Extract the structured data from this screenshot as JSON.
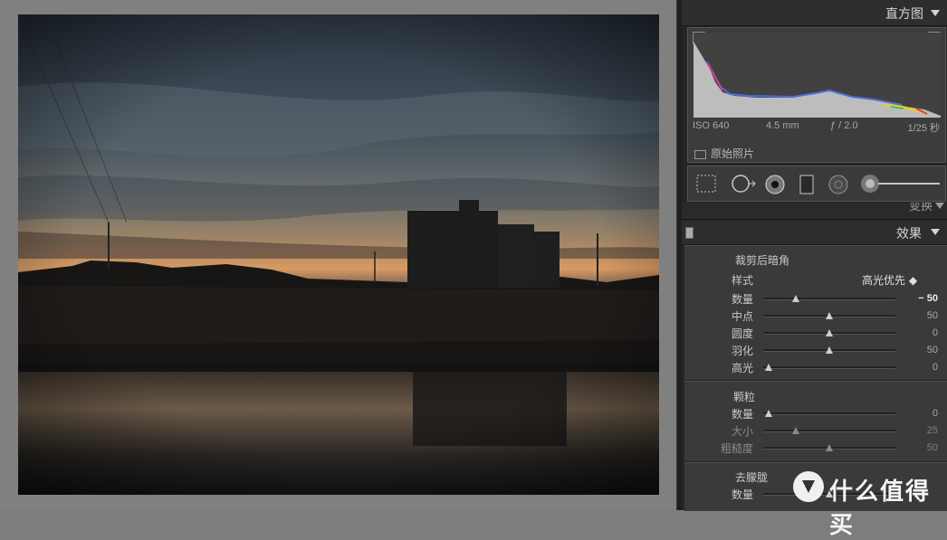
{
  "histogram": {
    "title": "直方图",
    "iso": "ISO 640",
    "focal": "4.5 mm",
    "aperture": "ƒ / 2.0",
    "shutter": "1/25 秒",
    "original_label": "原始照片"
  },
  "tools": [
    "crop-overlay",
    "spot-removal",
    "red-eye",
    "graduated-filter",
    "radial-filter",
    "adjustment-brush"
  ],
  "collapsed_section_label": "变换",
  "effects": {
    "title": "效果",
    "vignette": {
      "title": "裁剪后暗角",
      "style_label": "样式",
      "style_value": "高光优先 ◆",
      "sliders": [
        {
          "label": "数量",
          "value": "− 50",
          "pct": 0.25
        },
        {
          "label": "中点",
          "value": "50",
          "pct": 0.5
        },
        {
          "label": "圆度",
          "value": "0",
          "pct": 0.5
        },
        {
          "label": "羽化",
          "value": "50",
          "pct": 0.5
        },
        {
          "label": "高光",
          "value": "0",
          "pct": 0.0
        }
      ]
    },
    "grain": {
      "title": "颗粒",
      "sliders": [
        {
          "label": "数量",
          "value": "0",
          "pct": 0.0
        },
        {
          "label": "大小",
          "value": "25",
          "pct": 0.25
        },
        {
          "label": "粗糙度",
          "value": "50",
          "pct": 0.5
        }
      ]
    },
    "dehaze": {
      "title": "去朦胧",
      "sliders": [
        {
          "label": "数量",
          "value": "0",
          "pct": 0.5
        }
      ]
    }
  },
  "watermark": "什么值得买",
  "colors": {
    "panel": "#262626",
    "group": "#3a3a3a",
    "canvas": "#808080"
  }
}
